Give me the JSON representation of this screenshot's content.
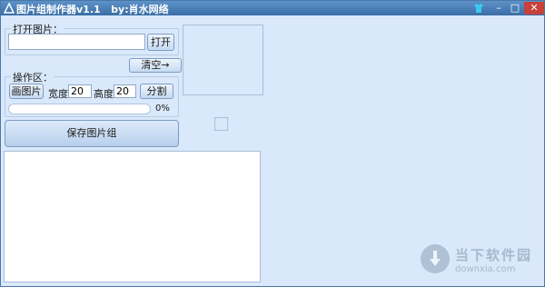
{
  "window": {
    "title": "图片组制作器v1.1   by:肖水网络",
    "controls": {
      "skin_icon": "shirt-icon",
      "minimize": "–",
      "maximize": "□",
      "close": "✕"
    }
  },
  "open_group": {
    "legend": "打开图片：",
    "path_value": "",
    "open_button": "打开"
  },
  "clear_button": "清空→",
  "ops_group": {
    "legend": "操作区：",
    "draw_button": "画图片",
    "width_label": "宽度:",
    "width_value": "20",
    "height_label": "高度:",
    "height_value": "20",
    "split_button": "分割"
  },
  "progress": {
    "value": 0,
    "label": "0%"
  },
  "save_button": "保存图片组",
  "watermark": {
    "cn": "当下软件园",
    "en": "downxia.com"
  },
  "colors": {
    "titlebar": "#3a6ea6",
    "background": "#d9e8fa",
    "close": "#c8413a"
  }
}
